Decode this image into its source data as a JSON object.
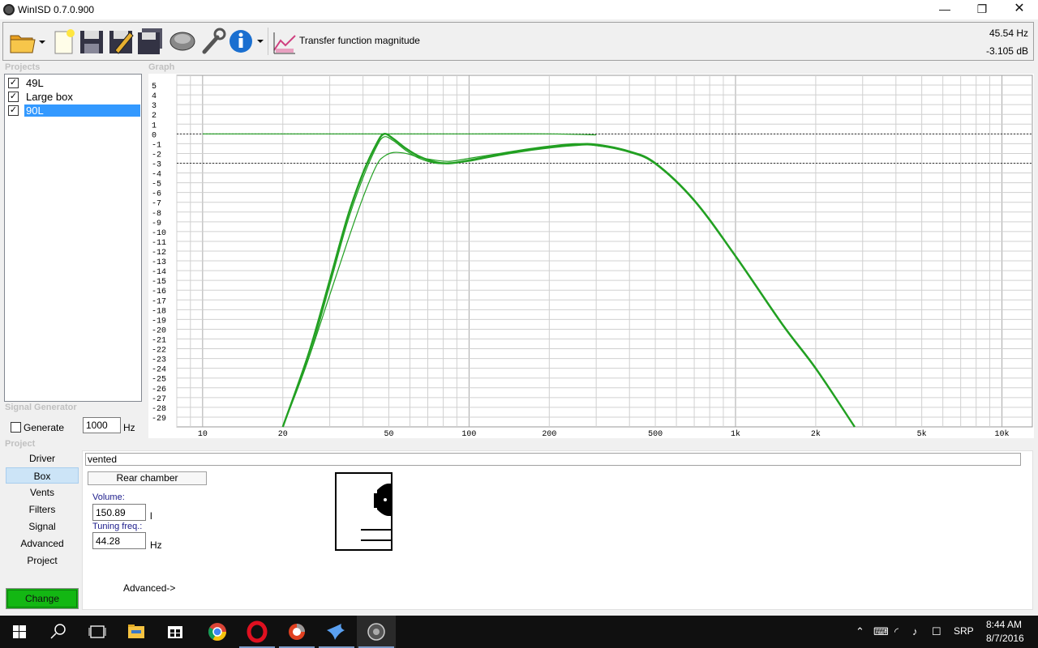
{
  "window": {
    "title": "WinISD 0.7.0.900",
    "minimize_glyph": "—",
    "maximize_glyph": "❐",
    "close_glyph": "✕"
  },
  "toolbar": {
    "buttons": [
      "open-folder-icon",
      "new-project-icon",
      "save-icon",
      "save-as-icon",
      "save-all-icon",
      "driver-icon",
      "settings-wrench-icon",
      "info-icon",
      "graph-type-icon"
    ],
    "graph_type_label": "Transfer function magnitude",
    "cursor_readout": {
      "frequency": "45.54 Hz",
      "level": "-3.105 dB"
    }
  },
  "sections": {
    "projects": "Projects",
    "graph": "Graph",
    "signal_generator": "Signal Generator",
    "project": "Project"
  },
  "projects": [
    {
      "name": "49L",
      "checked": true,
      "selected": false
    },
    {
      "name": "Large box",
      "checked": true,
      "selected": false
    },
    {
      "name": "90L",
      "checked": true,
      "selected": true
    }
  ],
  "signal_generator": {
    "label": "Generate",
    "checked": false,
    "frequency": "1000",
    "unit": "Hz"
  },
  "nav": {
    "items": [
      "Driver",
      "Box",
      "Vents",
      "Filters",
      "Signal",
      "Advanced",
      "Project"
    ],
    "active": "Box",
    "change_label": "Change"
  },
  "box": {
    "type": "vented",
    "chamber_button": "Rear chamber",
    "volume": {
      "label": "Volume:",
      "value": "150.89",
      "unit": "l"
    },
    "tuning": {
      "label": "Tuning freq.:",
      "value": "44.28",
      "unit": "Hz"
    },
    "advanced_label": "Advanced->"
  },
  "taskbar": {
    "apps": [
      "windows-start-icon",
      "search-icon",
      "task-view-icon",
      "file-explorer-icon",
      "store-icon",
      "chrome-icon",
      "opera-icon",
      "app-icon",
      "bird-app-icon",
      "winisd-icon"
    ],
    "tray": {
      "lang": "SRP",
      "time": "8:44 AM",
      "date": "8/7/2016"
    }
  },
  "colors": {
    "curve": "#22a022",
    "accent": "#3399ff",
    "change_button": "#13b713",
    "grid": "#c8c8c8"
  },
  "chart_data": {
    "type": "line",
    "x_scale": "log",
    "xlim": [
      8,
      13000
    ],
    "ylim": [
      -30,
      6
    ],
    "x_tick_labels": [
      {
        "x": 10,
        "label": "10"
      },
      {
        "x": 20,
        "label": "20"
      },
      {
        "x": 50,
        "label": "50"
      },
      {
        "x": 100,
        "label": "100"
      },
      {
        "x": 200,
        "label": "200"
      },
      {
        "x": 500,
        "label": "500"
      },
      {
        "x": 1000,
        "label": "1k"
      },
      {
        "x": 2000,
        "label": "2k"
      },
      {
        "x": 5000,
        "label": "5k"
      },
      {
        "x": 10000,
        "label": "10k"
      }
    ],
    "y_ticks": [
      5,
      4,
      3,
      2,
      1,
      0,
      -1,
      -2,
      -3,
      -4,
      -5,
      -6,
      -7,
      -8,
      -9,
      -10,
      -11,
      -12,
      -13,
      -14,
      -15,
      -16,
      -17,
      -18,
      -19,
      -20,
      -21,
      -22,
      -23,
      -24,
      -25,
      -26,
      -27,
      -28,
      -29
    ],
    "reference_lines": [
      0,
      -3
    ],
    "grid": true,
    "series": [
      {
        "x": [
          20,
          25,
          30,
          35,
          40,
          45,
          48,
          52,
          58,
          65,
          75,
          85,
          100,
          130,
          180,
          250,
          300,
          400,
          500,
          700,
          1000,
          1500,
          2000,
          2800
        ],
        "y": [
          -30,
          -22.5,
          -15,
          -8.5,
          -4,
          -1,
          0,
          -0.5,
          -1.5,
          -2.3,
          -2.9,
          -3,
          -2.7,
          -2.1,
          -1.5,
          -1.1,
          -1.1,
          -1.8,
          -3,
          -6.8,
          -12.5,
          -19.5,
          -24,
          -30
        ]
      },
      {
        "x": [
          20,
          25,
          30,
          35,
          40,
          45,
          48,
          52,
          58,
          65,
          75,
          85,
          100,
          130,
          180,
          250,
          300,
          400,
          500,
          700,
          1000,
          1500,
          2000,
          2800
        ],
        "y": [
          -30,
          -23,
          -16.5,
          -11,
          -6.5,
          -3.2,
          -2.3,
          -1.9,
          -2,
          -2.4,
          -2.7,
          -2.8,
          -2.5,
          -2,
          -1.4,
          -1,
          -1.2,
          -1.8,
          -3,
          -6.8,
          -12.5,
          -19.5,
          -24,
          -30
        ]
      },
      {
        "x": [
          20,
          25,
          30,
          35,
          40,
          45,
          48,
          52,
          58,
          65,
          75,
          85,
          100,
          130,
          180,
          250,
          300,
          400,
          500,
          700,
          1000,
          1500,
          2000,
          2800
        ],
        "y": [
          -30,
          -23,
          -15.5,
          -9,
          -4.5,
          -1.3,
          -0.3,
          -0.7,
          -1.7,
          -2.5,
          -3,
          -3,
          -2.8,
          -2.2,
          -1.6,
          -1.2,
          -1.2,
          -1.9,
          -3.1,
          -6.9,
          -12.6,
          -19.6,
          -24.1,
          -30
        ]
      },
      {
        "x": [
          10,
          100,
          200,
          300
        ],
        "y": [
          0,
          0,
          0,
          -0.1
        ]
      }
    ]
  }
}
